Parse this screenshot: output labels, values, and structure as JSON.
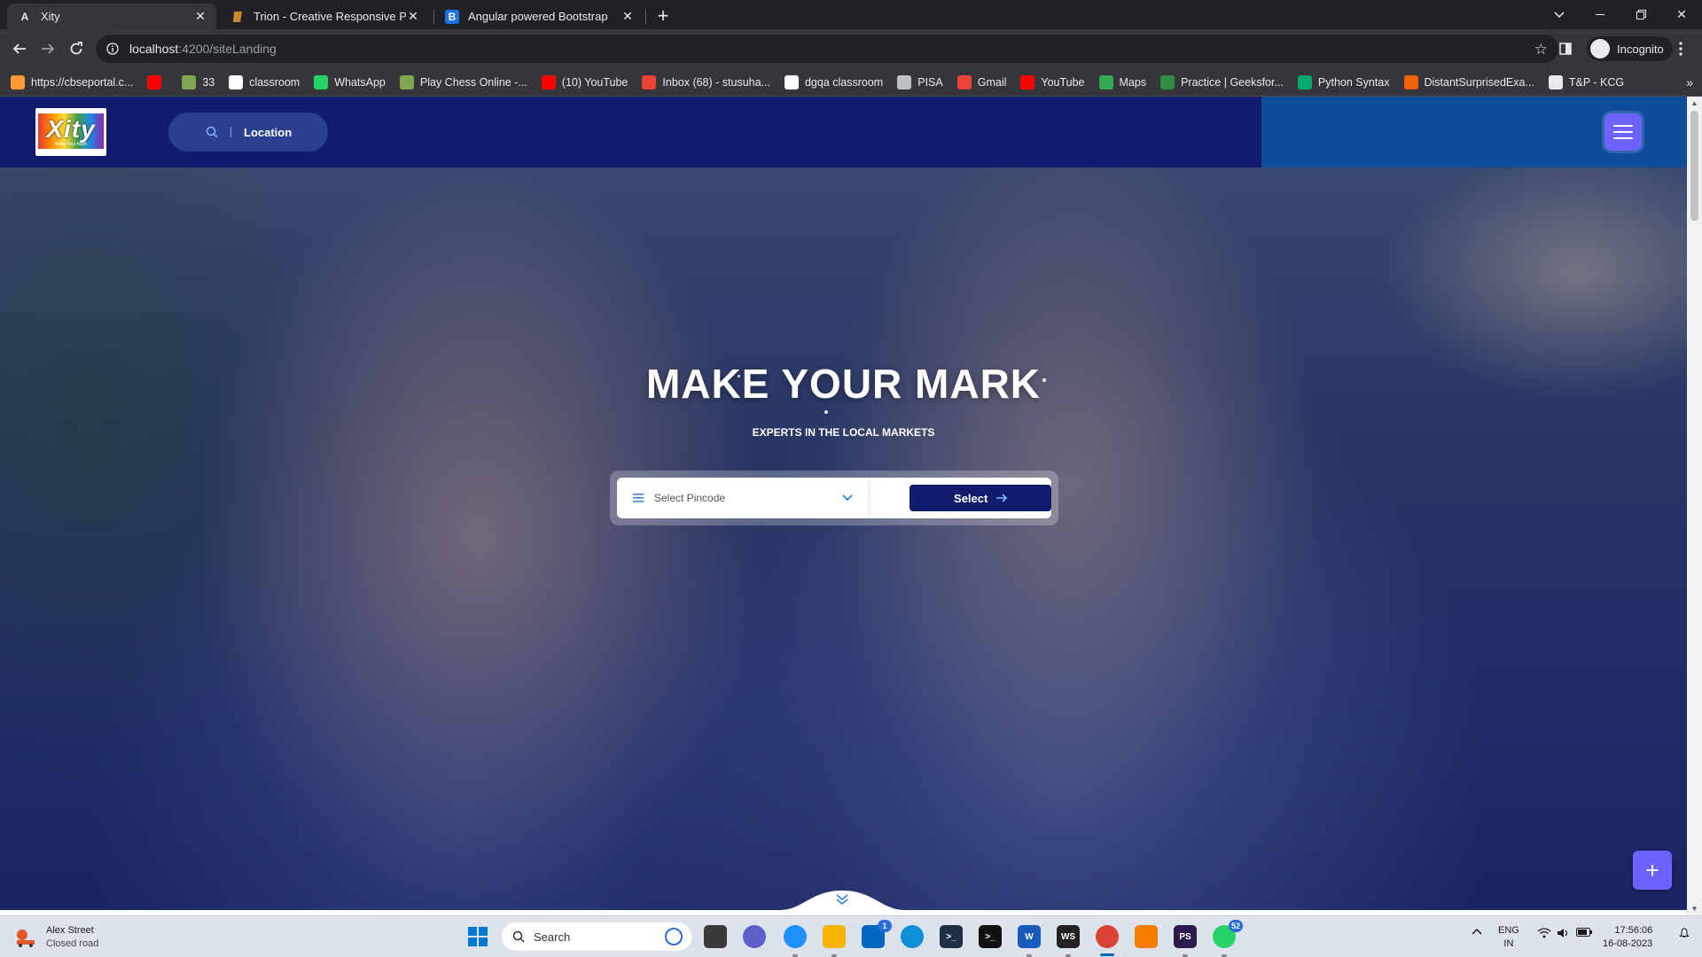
{
  "browser": {
    "tabs": [
      {
        "title": "Xity",
        "favicon": "A"
      },
      {
        "title": "Trion - Creative Responsive Perso",
        "favicon": "trion"
      },
      {
        "title": "Angular powered Bootstrap",
        "favicon": "B"
      }
    ],
    "url_host": "localhost",
    "url_path": ":4200/siteLanding",
    "profile_label": "Incognito",
    "bookmarks": [
      {
        "label": "https://cbseportal.c...",
        "icon": "flag-india",
        "color": "#ff9933"
      },
      {
        "label": "",
        "icon": "youtube-icon",
        "color": "#ff0000"
      },
      {
        "label": "33",
        "icon": "chess-icon",
        "color": "#7fa650"
      },
      {
        "label": "classroom",
        "icon": "google-icon",
        "color": "#ffffff"
      },
      {
        "label": "WhatsApp",
        "icon": "whatsapp-icon",
        "color": "#25d366"
      },
      {
        "label": "Play Chess Online -...",
        "icon": "chess-icon",
        "color": "#7fa650"
      },
      {
        "label": "(10) YouTube",
        "icon": "youtube-icon",
        "color": "#ff0000"
      },
      {
        "label": "Inbox (68) - stusuha...",
        "icon": "gmail-icon",
        "color": "#ea4335"
      },
      {
        "label": "dgqa classroom",
        "icon": "google-icon",
        "color": "#ffffff"
      },
      {
        "label": "PISA",
        "icon": "globe-icon",
        "color": "#bdc1c6"
      },
      {
        "label": "Gmail",
        "icon": "gmail-icon",
        "color": "#ea4335"
      },
      {
        "label": "YouTube",
        "icon": "youtube-icon",
        "color": "#ff0000"
      },
      {
        "label": "Maps",
        "icon": "maps-icon",
        "color": "#34a853"
      },
      {
        "label": "Practice | Geeksfor...",
        "icon": "gfg-icon",
        "color": "#2f8d46"
      },
      {
        "label": "Python Syntax",
        "icon": "w3-icon",
        "color": "#04aa6d"
      },
      {
        "label": "DistantSurprisedExa...",
        "icon": "replit-icon",
        "color": "#f26207"
      },
      {
        "label": "T&P - KCG",
        "icon": "page-icon",
        "color": "#e8eaed"
      }
    ]
  },
  "site": {
    "logo_text": "Xity",
    "logo_tagline": "Make Your Mark",
    "location_label": "Location",
    "hero_title": "MAKE YOUR MARK",
    "hero_subtitle": "EXPERTS IN THE LOCAL MARKETS",
    "pincode_placeholder": "Select Pincode",
    "select_button": "Select",
    "fab_label": "+",
    "colors": {
      "header": "#111c6c",
      "header_right": "#0e4c99",
      "accent": "#6c63ff"
    }
  },
  "taskbar": {
    "weather_title": "Alex Street",
    "weather_status": "Closed road",
    "search_placeholder": "Search",
    "store_badge": "1",
    "whatsapp_badge": "52",
    "lang_top": "ENG",
    "lang_bottom": "IN",
    "time": "17:56:06",
    "date": "16-08-2023"
  }
}
